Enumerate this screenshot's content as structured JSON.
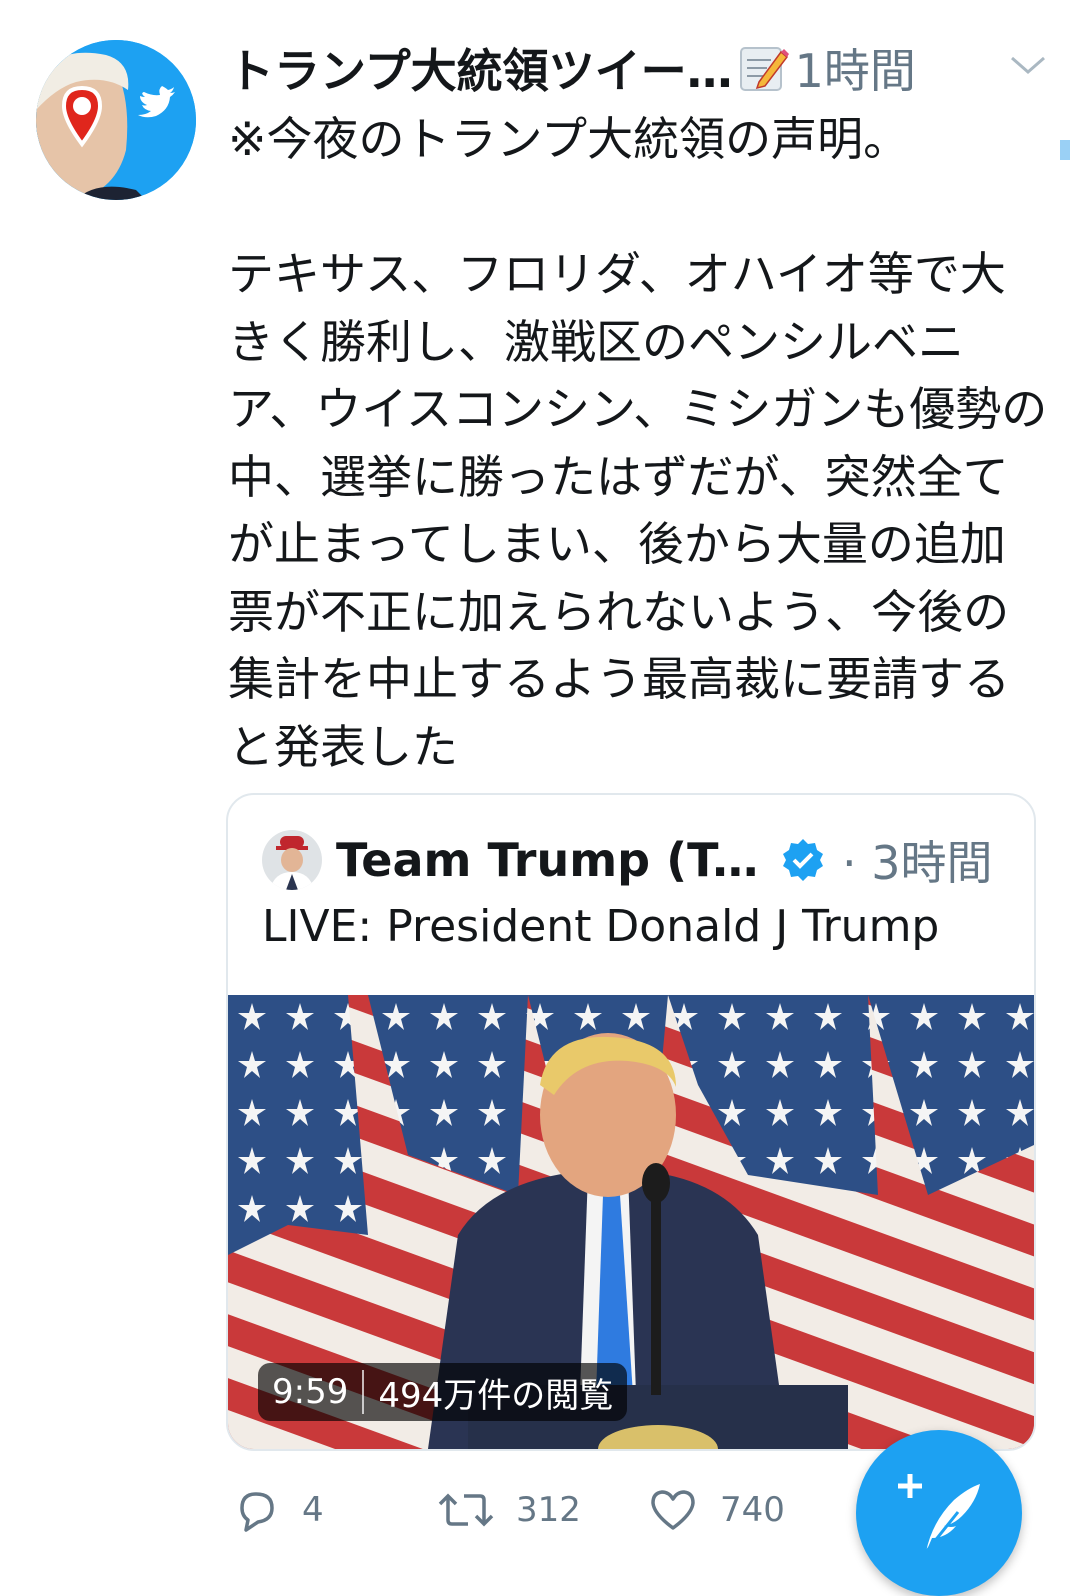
{
  "tweet": {
    "display_name": "トランプ大統領ツイー…",
    "timestamp": "1時間",
    "text": "※今夜のトランプ大統領の声明。\n\nテキサス、フロリダ、オハイオ等で大きく勝利し、激戦区のペンシルベニア、ウイスコンシン、ミシガンも優勢の中、選挙に勝ったはずだが、突然全てが止まってしまい、後から大量の追加票が不正に加えられないよう、今後の集計を中止するよう最高裁に要請すると発表した"
  },
  "quoted_tweet": {
    "display_name": "Team Trump (Te…",
    "timestamp": "· 3時間",
    "text": "LIVE: President Donald J Trump",
    "video": {
      "duration": "9:59",
      "views": "494万件の閲覧"
    }
  },
  "actions": {
    "reply_count": "4",
    "retweet_count": "312",
    "like_count": "740"
  },
  "colors": {
    "twitter_blue": "#1da1f2",
    "secondary_text": "#657786",
    "border": "#e1e8ed"
  },
  "icons": [
    "twitter-bird-icon",
    "memo-icon",
    "chevron-down-icon",
    "verified-icon",
    "reply-icon",
    "retweet-icon",
    "like-icon",
    "compose-tweet-icon"
  ]
}
